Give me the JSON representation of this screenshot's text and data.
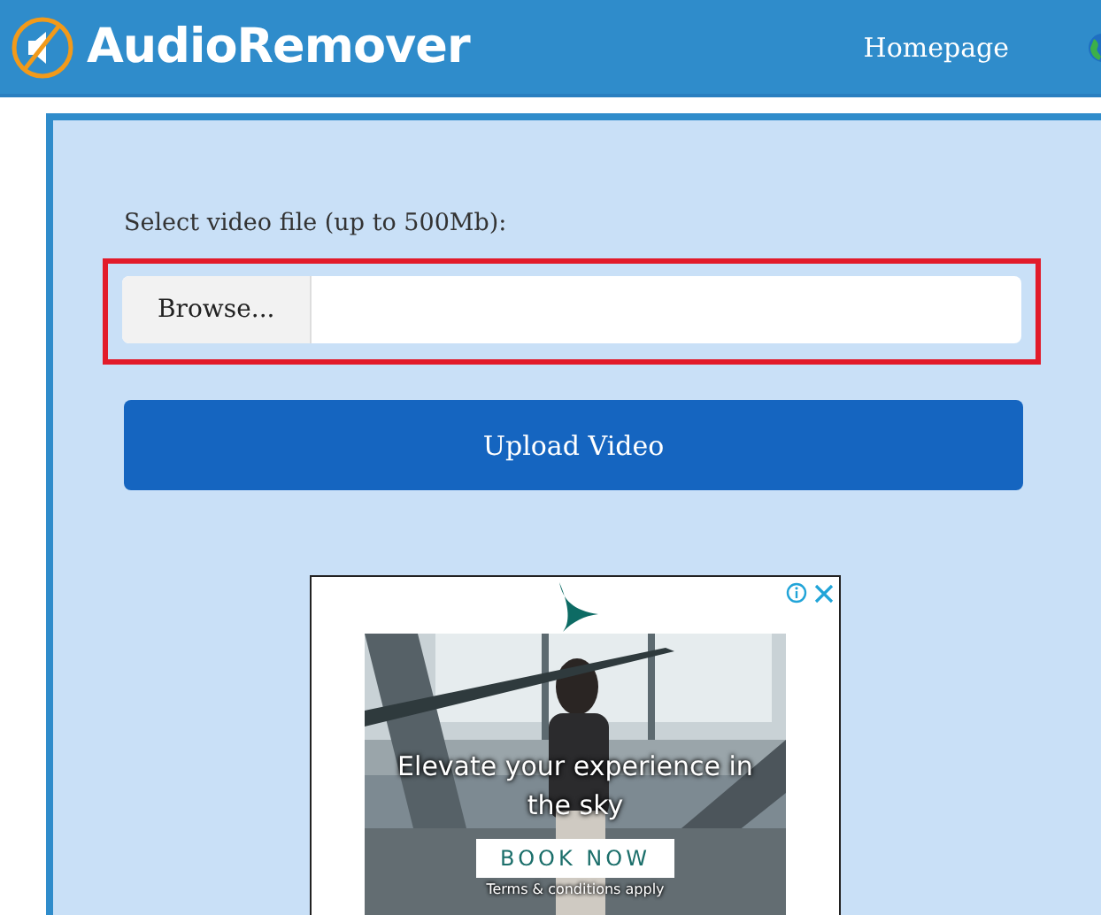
{
  "header": {
    "brand": "AudioRemover",
    "nav": [
      {
        "label": "Homepage"
      }
    ]
  },
  "form": {
    "label": "Select video file (up to 500Mb):",
    "browse_button": "Browse...",
    "upload_button": "Upload Video"
  },
  "ad": {
    "kind": "picture",
    "headline": "Elevate your experience in the sky",
    "cta": "BOOK NOW",
    "fine_print": "Terms & conditions apply"
  }
}
